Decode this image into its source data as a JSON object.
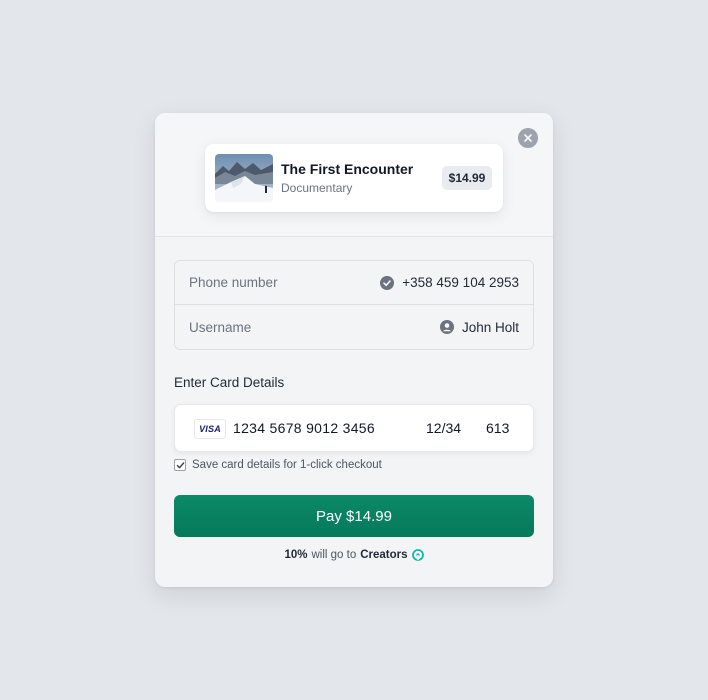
{
  "product": {
    "title": "The First Encounter",
    "category": "Documentary",
    "price": "$14.99"
  },
  "account": {
    "phone_label": "Phone number",
    "phone_value": "+358 459 104 2953",
    "username_label": "Username",
    "username_value": "John Holt"
  },
  "card": {
    "section_title": "Enter Card Details",
    "brand": "VISA",
    "number": "1234 5678 9012 3456",
    "expiry": "12/34",
    "cvc": "613"
  },
  "save_card": {
    "checked": true,
    "label": "Save card details for 1-click checkout"
  },
  "pay_button": {
    "label": "Pay $14.99"
  },
  "footnote": {
    "percent": "10%",
    "middle": "will go to",
    "target": "Creators"
  },
  "colors": {
    "background": "#e3e6ea",
    "modal": "#f3f4f6",
    "accent": "#0b8a68",
    "creators_icon": "#14b8a6"
  },
  "icons": {
    "close": "close-icon",
    "phone_verified": "check-circle-icon",
    "user": "user-circle-icon",
    "checkbox": "check-icon",
    "creators": "creators-icon"
  }
}
